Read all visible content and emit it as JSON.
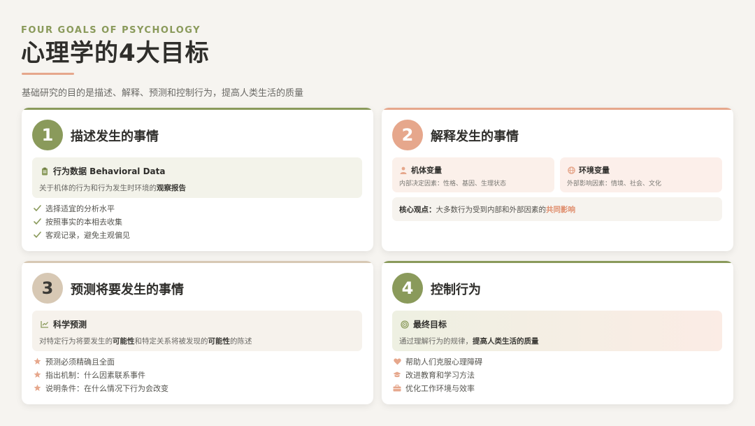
{
  "header": {
    "subtitle_en": "FOUR GOALS OF PSYCHOLOGY",
    "title": "心理学的4大目标",
    "intro": "基础研究的目的是描述、解释、预测和控制行为，提高人类生活的质量"
  },
  "colors": {
    "green": "#8a9a5b",
    "salmon": "#e6a78c",
    "tan": "#d7c8b4",
    "accent_text": "#e08e6d"
  },
  "cards": [
    {
      "number": "1",
      "title": "描述发生的事情",
      "box": {
        "icon": "clipboard-icon",
        "heading": "行为数据 Behavioral Data",
        "desc_pre": "关于机体的行为和行为发生时环境的",
        "desc_bold": "观察报告"
      },
      "items": [
        {
          "icon": "check-icon",
          "text": "选择适宜的分析水平"
        },
        {
          "icon": "check-icon",
          "text": "按照事实的本相去收集"
        },
        {
          "icon": "check-icon",
          "text": "客观记录，避免主观偏见"
        }
      ]
    },
    {
      "number": "2",
      "title": "解释发生的事情",
      "variables": [
        {
          "icon": "person-icon",
          "heading": "机体变量",
          "desc": "内部决定因素：性格、基因、生理状态"
        },
        {
          "icon": "globe-icon",
          "heading": "环境变量",
          "desc": "外部影响因素：情境、社会、文化"
        }
      ],
      "core": {
        "label": "核心观点：",
        "text": "大多数行为受到内部和外部因素的",
        "accent": "共同影响"
      }
    },
    {
      "number": "3",
      "title": "预测将要发生的事情",
      "box": {
        "icon": "chart-line-icon",
        "heading": "科学预测",
        "desc_1": "对特定行为将要发生的",
        "desc_bold_1": "可能性",
        "desc_2": "和特定关系将被发现的",
        "desc_bold_2": "可能性",
        "desc_3": "的陈述"
      },
      "items": [
        {
          "icon": "star-icon",
          "text": "预测必须精确且全面"
        },
        {
          "icon": "star-icon",
          "text": "指出机制：什么因素联系事件"
        },
        {
          "icon": "star-icon",
          "text": "说明条件：在什么情况下行为会改变"
        }
      ]
    },
    {
      "number": "4",
      "title": "控制行为",
      "box": {
        "icon": "target-icon",
        "heading": "最终目标",
        "desc_pre": "通过理解行为的规律，",
        "desc_bold": "提高人类生活的质量"
      },
      "items": [
        {
          "icon": "heart-icon",
          "text": "帮助人们克服心理障碍"
        },
        {
          "icon": "graduation-cap-icon",
          "text": "改进教育和学习方法"
        },
        {
          "icon": "briefcase-icon",
          "text": "优化工作环境与效率"
        }
      ]
    }
  ]
}
